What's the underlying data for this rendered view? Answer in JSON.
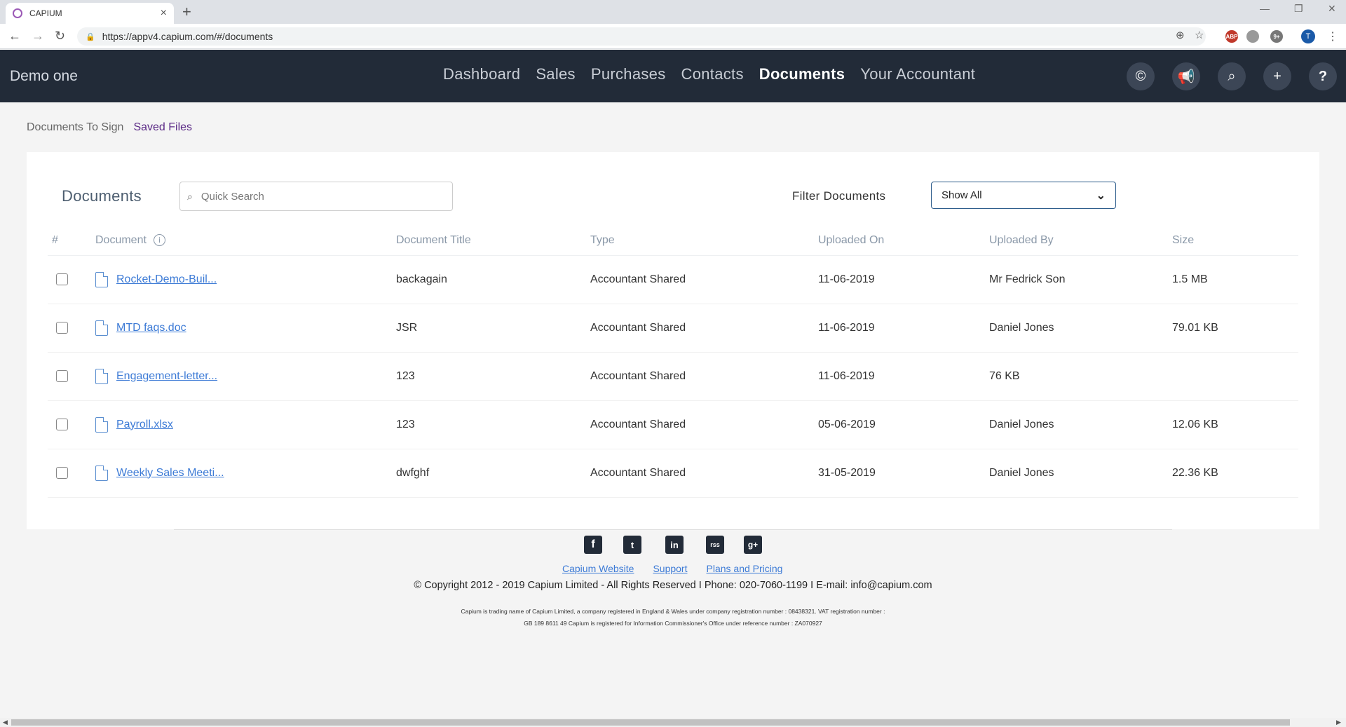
{
  "browser": {
    "tab_title": "CAPIUM",
    "url": "https://appv4.capium.com/#/documents",
    "profile_initial": "T",
    "ext_abp": "ABP",
    "ext_badge": "9+"
  },
  "app": {
    "brand": "Demo one",
    "nav": [
      "Dashboard",
      "Sales",
      "Purchases",
      "Contacts",
      "Documents",
      "Your Accountant"
    ],
    "active_nav": "Documents",
    "header_icons": [
      "capium-logo-icon",
      "megaphone-icon",
      "search-icon",
      "plus-icon",
      "help-icon"
    ]
  },
  "subtabs": [
    "Documents To Sign",
    "Saved Files"
  ],
  "active_subtab": "Saved Files",
  "documents": {
    "title": "Documents",
    "search_placeholder": "Quick Search",
    "filter_label": "Filter Documents",
    "filter_value": "Show All",
    "columns": [
      "#",
      "Document",
      "Document Title",
      "Type",
      "Uploaded On",
      "Uploaded By",
      "Size"
    ],
    "rows": [
      {
        "document": "Rocket-Demo-Buil...",
        "title": "backagain",
        "type": "Accountant Shared",
        "uploaded_on": "11-06-2019",
        "uploaded_by": "Mr Fedrick Son",
        "size": "1.5 MB",
        "file_kind": "PDF"
      },
      {
        "document": "MTD faqs.doc",
        "title": "JSR",
        "type": "Accountant Shared",
        "uploaded_on": "11-06-2019",
        "uploaded_by": "Daniel Jones",
        "size": "79.01 KB",
        "file_kind": "DOC"
      },
      {
        "document": "Engagement-letter...",
        "title": "123",
        "type": "Accountant Shared",
        "uploaded_on": "11-06-2019",
        "uploaded_by": "76 KB",
        "size": "",
        "file_kind": "DOC"
      },
      {
        "document": "Payroll.xlsx",
        "title": "123",
        "type": "Accountant Shared",
        "uploaded_on": "05-06-2019",
        "uploaded_by": "Daniel Jones",
        "size": "12.06 KB",
        "file_kind": "XLS"
      },
      {
        "document": "Weekly Sales Meeti...",
        "title": "dwfghf",
        "type": "Accountant Shared",
        "uploaded_on": "31-05-2019",
        "uploaded_by": "Daniel Jones",
        "size": "22.36 KB",
        "file_kind": "XLS"
      }
    ]
  },
  "footer": {
    "social": [
      "f",
      "t",
      "in",
      "rss",
      "g+"
    ],
    "links": [
      "Capium Website",
      "Support",
      "Plans and Pricing"
    ],
    "copyright": "© Copyright 2012 - 2019 Capium Limited - All Rights Reserved I Phone: 020-7060-1199 I E-mail: info@capium.com",
    "fine_print_1": "Capium is trading name of Capium Limited, a company registered in England & Wales under company registration number : 08438321. VAT registration number :",
    "fine_print_2": "GB 189 8611 49 Capium is registered for Information Commissioner's Office under reference number : ZA070927"
  },
  "colors": {
    "header_bg": "#222b38",
    "active_subtab": "#5b2a86",
    "link": "#3d7bd6"
  }
}
